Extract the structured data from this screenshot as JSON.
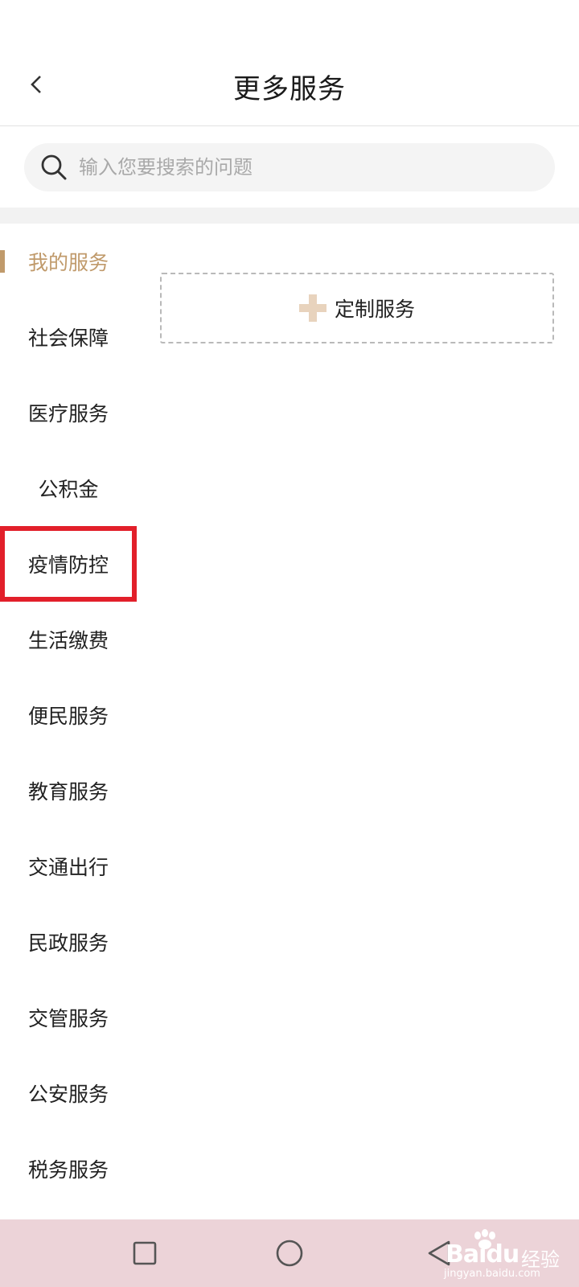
{
  "header": {
    "title": "更多服务",
    "back_icon": "chevron-left-icon"
  },
  "search": {
    "placeholder": "输入您要搜索的问题",
    "value": "",
    "icon": "search-icon"
  },
  "sidebar": {
    "items": [
      {
        "label": "我的服务",
        "state": "active"
      },
      {
        "label": "社会保障"
      },
      {
        "label": "医疗服务"
      },
      {
        "label": "公积金"
      },
      {
        "label": "疫情防控",
        "state": "highlighted"
      },
      {
        "label": "生活缴费"
      },
      {
        "label": "便民服务"
      },
      {
        "label": "教育服务"
      },
      {
        "label": "交通出行"
      },
      {
        "label": "民政服务"
      },
      {
        "label": "交管服务"
      },
      {
        "label": "公安服务"
      },
      {
        "label": "税务服务"
      }
    ]
  },
  "content": {
    "custom_service_label": "定制服务",
    "add_icon": "plus-icon"
  },
  "system_nav": {
    "buttons": [
      "recent-apps-icon",
      "home-icon",
      "back-triangle-icon"
    ]
  },
  "watermark": {
    "brand": "Bai",
    "brand_suffix": "du",
    "cn": "经验",
    "url": "jingyan.baidu.com"
  },
  "colors": {
    "accent": "#c09a6b",
    "highlight_box": "#e21f2a",
    "plus": "#e8d3bd",
    "nav_bar": "#ecd3d8"
  }
}
